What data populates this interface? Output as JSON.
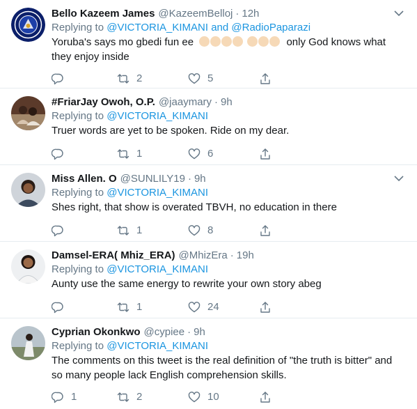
{
  "tweets": [
    {
      "name": "Bello Kazeem James",
      "handle": "@KazeemBelloj",
      "dot": "·",
      "time": "12h",
      "replying_prefix": "Replying to",
      "replying_mention_1": "@VICTORIA_KIMANI",
      "replying_joiner": "and",
      "replying_mention_2": "@RadioPaparazi",
      "text_before_emoji": "Yoruba's says mo gbedi fun ee",
      "text_after_emoji": "only God knows what they enjoy inside",
      "reply_count": "",
      "retweet_count": "2",
      "like_count": "5",
      "avatar_icon": "chelsea-crest-icon"
    },
    {
      "name": "#FriarJay Owoh, O.P.",
      "handle": "@jaaymary",
      "dot": "·",
      "time": "9h",
      "replying_prefix": "Replying to",
      "replying_mention_1": "@VICTORIA_KIMANI",
      "text": "Truer words are yet to be spoken. Ride on my dear.",
      "reply_count": "",
      "retweet_count": "1",
      "like_count": "6",
      "avatar_icon": "photo-avatar-icon"
    },
    {
      "name": "Miss Allen. O",
      "handle": "@SUNLILY19",
      "dot": "·",
      "time": "9h",
      "replying_prefix": "Replying to",
      "replying_mention_1": "@VICTORIA_KIMANI",
      "text": "Shes right, that show is overated TBVH, no education in there",
      "reply_count": "",
      "retweet_count": "1",
      "like_count": "8",
      "avatar_icon": "photo-avatar-icon"
    },
    {
      "name": "Damsel-ERA( Mhiz_ERA)",
      "handle": "@MhizEra",
      "dot": "·",
      "time": "19h",
      "replying_prefix": "Replying to",
      "replying_mention_1": "@VICTORIA_KIMANI",
      "text": "Aunty use the same energy to rewrite your own story abeg",
      "reply_count": "",
      "retweet_count": "1",
      "like_count": "24",
      "avatar_icon": "photo-avatar-icon"
    },
    {
      "name": "Cyprian Okonkwo",
      "handle": "@cypiee",
      "dot": "·",
      "time": "9h",
      "replying_prefix": "Replying to",
      "replying_mention_1": "@VICTORIA_KIMANI",
      "text": "The comments on this tweet is the real definition of \"the truth is bitter\" and so many people lack English comprehension skills.",
      "reply_count": "1",
      "retweet_count": "2",
      "like_count": "10",
      "avatar_icon": "photo-avatar-icon"
    }
  ],
  "colors": {
    "link": "#1b95e0",
    "secondary_text": "#657786",
    "divider": "#e6ecf0"
  }
}
